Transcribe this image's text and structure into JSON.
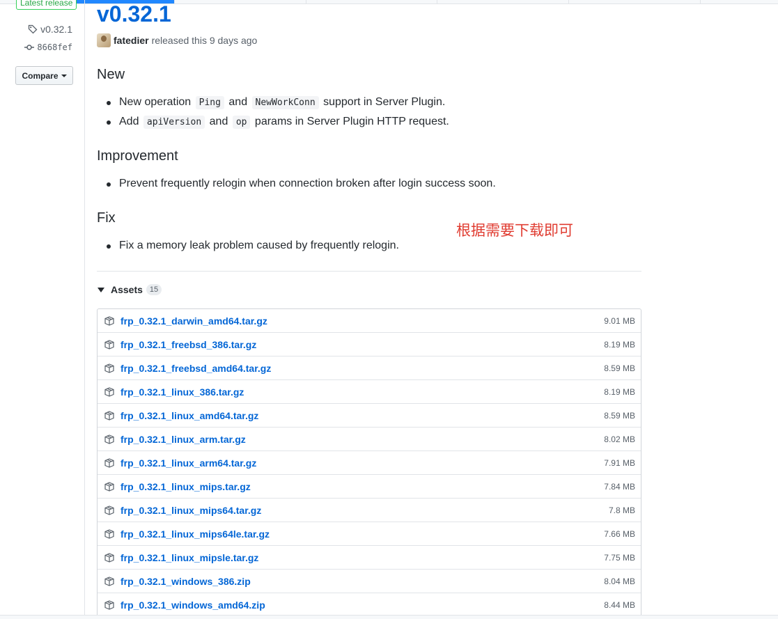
{
  "sidebar": {
    "badge": "Latest release",
    "tag": "v0.32.1",
    "commit": "8668fef",
    "compare_label": "Compare"
  },
  "release": {
    "title": "v0.32.1",
    "author": "fatedier",
    "released_text": "released this 9 days ago"
  },
  "sections": {
    "new": {
      "heading": "New",
      "items": [
        {
          "a": "New operation",
          "code1": "Ping",
          "b": "and",
          "code2": "NewWorkConn",
          "c": "support in Server Plugin."
        },
        {
          "a": "Add",
          "code1": "apiVersion",
          "b": "and",
          "code2": "op",
          "c": "params in Server Plugin HTTP request."
        }
      ]
    },
    "improvement": {
      "heading": "Improvement",
      "items": [
        "Prevent frequently relogin when connection broken after login success soon."
      ]
    },
    "fix": {
      "heading": "Fix",
      "items": [
        "Fix a memory leak problem caused by frequently relogin."
      ]
    }
  },
  "annotation": "根据需要下载即可",
  "assets": {
    "label": "Assets",
    "count": "15",
    "files": [
      {
        "name": "frp_0.32.1_darwin_amd64.tar.gz",
        "size": "9.01 MB"
      },
      {
        "name": "frp_0.32.1_freebsd_386.tar.gz",
        "size": "8.19 MB"
      },
      {
        "name": "frp_0.32.1_freebsd_amd64.tar.gz",
        "size": "8.59 MB"
      },
      {
        "name": "frp_0.32.1_linux_386.tar.gz",
        "size": "8.19 MB"
      },
      {
        "name": "frp_0.32.1_linux_amd64.tar.gz",
        "size": "8.59 MB"
      },
      {
        "name": "frp_0.32.1_linux_arm.tar.gz",
        "size": "8.02 MB"
      },
      {
        "name": "frp_0.32.1_linux_arm64.tar.gz",
        "size": "7.91 MB"
      },
      {
        "name": "frp_0.32.1_linux_mips.tar.gz",
        "size": "7.84 MB"
      },
      {
        "name": "frp_0.32.1_linux_mips64.tar.gz",
        "size": "7.8 MB"
      },
      {
        "name": "frp_0.32.1_linux_mips64le.tar.gz",
        "size": "7.66 MB"
      },
      {
        "name": "frp_0.32.1_linux_mipsle.tar.gz",
        "size": "7.75 MB"
      },
      {
        "name": "frp_0.32.1_windows_386.zip",
        "size": "8.04 MB"
      },
      {
        "name": "frp_0.32.1_windows_amd64.zip",
        "size": "8.44 MB"
      }
    ]
  },
  "colors": {
    "link": "#0366d6",
    "annotation": "#e03c31",
    "badge": "#28a745"
  }
}
